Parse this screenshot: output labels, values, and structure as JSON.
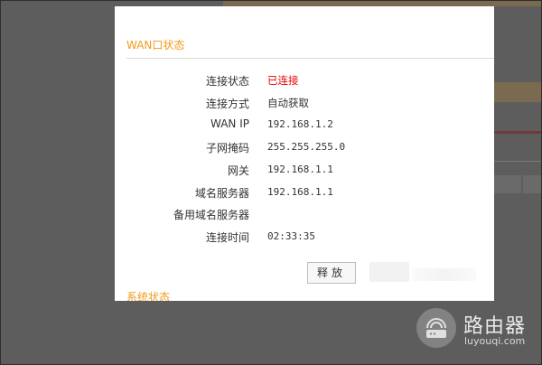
{
  "dialog": {
    "title": "WAN口状态",
    "rows": [
      {
        "label": "连接状态",
        "value": "已连接",
        "status": true
      },
      {
        "label": "连接方式",
        "value": "自动获取"
      },
      {
        "label": "WAN IP",
        "value": "192.168.1.2",
        "mono": true
      },
      {
        "label": "子网掩码",
        "value": "255.255.255.0",
        "mono": true
      },
      {
        "label": "网关",
        "value": "192.168.1.1",
        "mono": true
      },
      {
        "label": "域名服务器",
        "value": "192.168.1.1",
        "mono": true
      },
      {
        "label": "备用域名服务器",
        "value": ""
      },
      {
        "label": "连接时间",
        "value": "02:33:35",
        "mono": true
      }
    ],
    "release_button": "释放",
    "next_section_title": "系统状态"
  },
  "watermark": {
    "brand": "路由器",
    "domain": "luyouqi.com",
    "icon": "router-icon"
  },
  "colors": {
    "accent": "#f39a1a",
    "status_connected": "#e60000",
    "overlay": "#5d5d5d"
  }
}
